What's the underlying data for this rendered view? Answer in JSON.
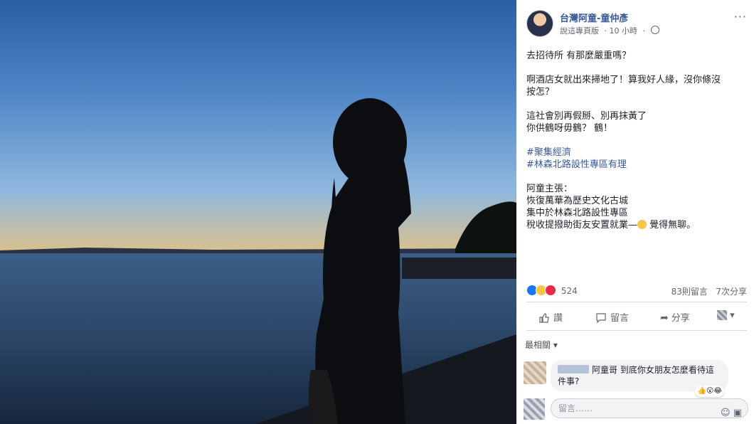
{
  "post": {
    "page_name": "台灣阿童-童仲彥",
    "editor_tag": "說這專頁版",
    "time": "10 小時",
    "lines": [
      "去招待所 有那麼嚴重嗎？",
      "",
      "啊酒店女就出來掃地了！算我好人緣，沒你條沒",
      "按怎？",
      "",
      "這社會別再假掰、別再抹黃了",
      "你供鶴呀毋鶴？ 鶴！",
      "",
      "#聚集經濟",
      "#林森北路設性專區有理",
      "",
      "阿童主張：",
      "恢復萬華為歷史文化古城",
      "集中於林森北路設性專區",
      "稅收提撥助街友安置就業—",
      "覺得無聊。"
    ]
  },
  "stats": {
    "reactions_count": "524",
    "comments": "83則留言",
    "shares": "7次分享"
  },
  "actions": {
    "like": "讚",
    "comment": "留言",
    "share": "分享"
  },
  "comments_section": {
    "sort_label": "最相關 ▾",
    "comment_text": "阿童哥 到底你女朋友怎麼看待這件事?",
    "input_placeholder": "留言……"
  },
  "colors": {
    "link": "#385898",
    "like_blue": "#1877f2",
    "text": "#1d2129",
    "muted": "#606770"
  }
}
